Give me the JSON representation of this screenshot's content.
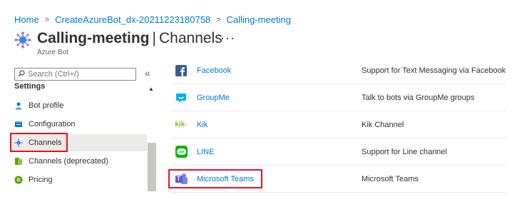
{
  "breadcrumb": {
    "items": [
      "Home",
      "CreateAzureBot_dx-20211223180758",
      "Calling-meeting"
    ],
    "separator": ">"
  },
  "header": {
    "title": "Calling-meeting",
    "divider": "|",
    "section": "Channels",
    "subtitle": "Azure Bot",
    "more": "···"
  },
  "search": {
    "placeholder": "Search (Ctrl+/)",
    "value": ""
  },
  "collapse_glyph": "«",
  "sidebar": {
    "section": "Settings",
    "items": [
      {
        "label": "Bot profile",
        "icon": "bot-profile-icon"
      },
      {
        "label": "Configuration",
        "icon": "configuration-icon"
      },
      {
        "label": "Channels",
        "icon": "channels-icon",
        "selected": true
      },
      {
        "label": "Channels (deprecated)",
        "icon": "channels-deprecated-icon"
      },
      {
        "label": "Pricing",
        "icon": "pricing-icon"
      }
    ]
  },
  "channels": [
    {
      "name": "Facebook",
      "description": "Support for Text Messaging via Facebook",
      "icon": "facebook-icon"
    },
    {
      "name": "GroupMe",
      "description": "Talk to bots via GroupMe groups",
      "icon": "groupme-icon"
    },
    {
      "name": "Kik",
      "description": "Kik Channel",
      "icon": "kik-icon",
      "icon_text": "kik·"
    },
    {
      "name": "LINE",
      "description": "Support for Line channel",
      "icon": "line-icon",
      "icon_text": "LINE"
    },
    {
      "name": "Microsoft Teams",
      "description": "Microsoft Teams",
      "icon": "teams-icon",
      "icon_text": "T"
    }
  ],
  "colors": {
    "link": "#0078d4",
    "highlight": "#e81123",
    "facebook": "#3b5998",
    "groupme": "#00aff0",
    "kik": "#82bc23",
    "line": "#00b900",
    "teams": "#5b5fc7"
  }
}
